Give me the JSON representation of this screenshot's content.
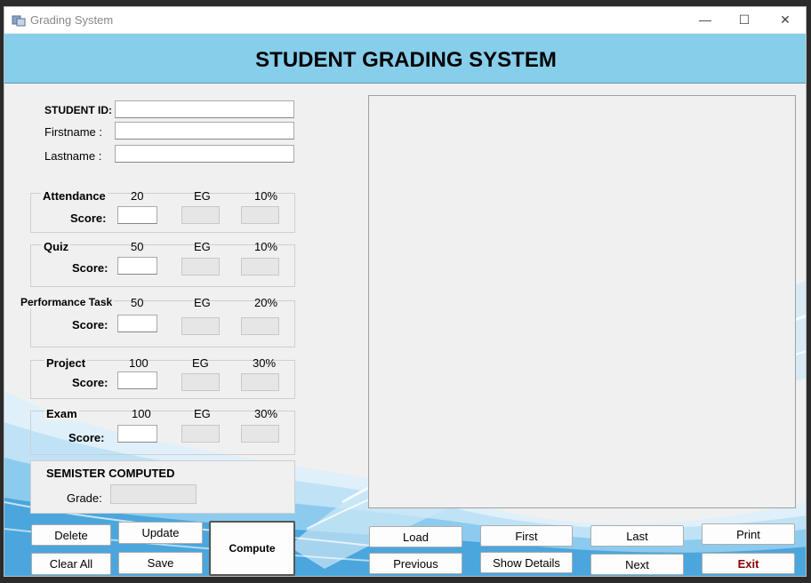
{
  "window": {
    "title": "Grading System",
    "minimize_glyph": "—",
    "maximize_glyph": "☐",
    "close_glyph": "✕"
  },
  "header": {
    "title": "STUDENT GRADING SYSTEM"
  },
  "student": {
    "id_label": "STUDENT ID:",
    "firstname_label": "Firstname :",
    "lastname_label": "Lastname :",
    "id_value": "",
    "firstname_value": "",
    "lastname_value": ""
  },
  "components": [
    {
      "name": "Attendance",
      "max": "20",
      "eg": "EG",
      "weight": "10%",
      "score_label": "Score:",
      "score": ""
    },
    {
      "name": "Quiz",
      "max": "50",
      "eg": "EG",
      "weight": "10%",
      "score_label": "Score:",
      "score": ""
    },
    {
      "name": "Performance Task",
      "max": "50",
      "eg": "EG",
      "weight": "20%",
      "score_label": "Score:",
      "score": ""
    },
    {
      "name": "Project",
      "max": "100",
      "eg": "EG",
      "weight": "30%",
      "score_label": "Score:",
      "score": ""
    },
    {
      "name": "Exam",
      "max": "100",
      "eg": "EG",
      "weight": "30%",
      "score_label": "Score:",
      "score": ""
    }
  ],
  "semester": {
    "title": "SEMISTER COMPUTED",
    "grade_label": "Grade:",
    "grade_value": ""
  },
  "buttons": {
    "delete": "Delete",
    "update": "Update",
    "compute": "Compute",
    "clear_all": "Clear All",
    "save": "Save",
    "load": "Load",
    "first": "First",
    "last": "Last",
    "print": "Print",
    "previous": "Previous",
    "show_details": "Show Details",
    "next": "Next",
    "exit": "Exit"
  },
  "colors": {
    "header_bg": "#87ceeb",
    "exit_text": "#8b0000",
    "swirl": "#4aa6dd"
  },
  "icons": {
    "app": "app-icon",
    "minimize": "minimize-icon",
    "maximize": "maximize-icon",
    "close": "close-icon"
  }
}
